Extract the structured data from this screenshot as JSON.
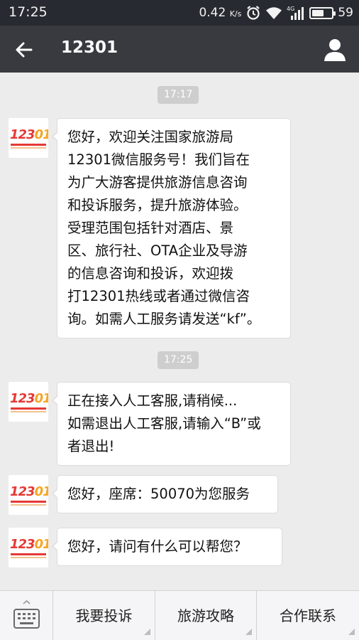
{
  "status_bar": {
    "time": "17:25",
    "net_speed": "0.42",
    "net_unit": "K/s",
    "network_type": "4G",
    "battery": "59"
  },
  "header": {
    "title": "12301",
    "back_icon": "arrow-left-icon",
    "profile_icon": "person-icon"
  },
  "chat": {
    "avatar_logo": {
      "num_a": "123",
      "num_b": "01",
      "subtitle": "国家旅游服务热线"
    },
    "items": [
      {
        "kind": "time",
        "text": "17:17"
      },
      {
        "kind": "message",
        "lines": [
          "您好，欢迎关注国家旅游局",
          "12301微信服务号！我们旨在",
          "为广大游客提供旅游信息咨询",
          "和投诉服务，提升旅游体验。",
          "受理范围包括针对酒店、景",
          "区、旅行社、OTA企业及导游",
          "的信息咨询和投诉，欢迎拨",
          "打12301热线或者通过微信咨",
          "询。如需人工服务请发送“kf”。"
        ]
      },
      {
        "kind": "time",
        "text": "17:25"
      },
      {
        "kind": "message",
        "lines": [
          "正在接入人工客服,请稍候...",
          "如需退出人工客服,请输入“B”或",
          "者退出!"
        ]
      },
      {
        "kind": "message",
        "lines": [
          "您好，座席：50070为您服务"
        ]
      },
      {
        "kind": "message",
        "lines": [
          "您好，请问有什么可以帮您？"
        ]
      }
    ]
  },
  "bottom_menu": {
    "keyboard_icon": "keyboard-icon",
    "items": [
      {
        "label": "我要投诉"
      },
      {
        "label": "旅游攻略"
      },
      {
        "label": "合作联系"
      }
    ]
  },
  "colors": {
    "status_bg": "#272a30",
    "title_bg": "#393a3f",
    "chat_bg": "#ececec",
    "logo_red": "#e53935",
    "logo_orange": "#f5a623"
  }
}
